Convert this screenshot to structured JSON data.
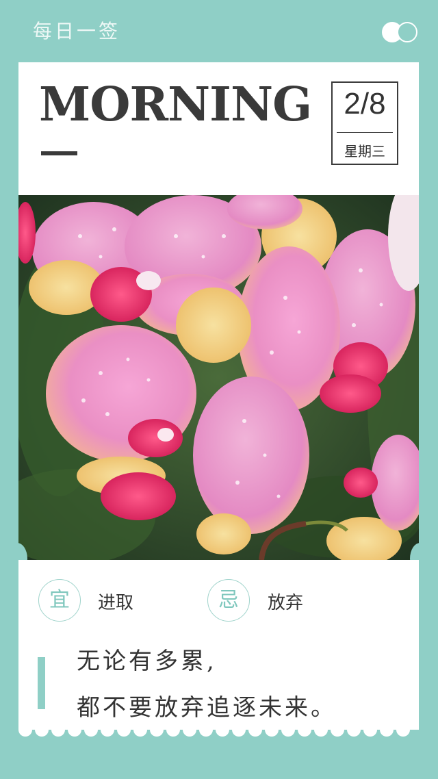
{
  "header": {
    "title": "每日一签",
    "toggle_icon": "toggle-icon"
  },
  "card": {
    "greeting": "MORNING",
    "date": "2/8",
    "weekday": "星期三"
  },
  "photo": {
    "image_icon": "orchid-photo"
  },
  "fortune": {
    "yi_label": "宜",
    "yi_text": "进取",
    "ji_label": "忌",
    "ji_text": "放弃"
  },
  "quote": {
    "line1": "无论有多累,",
    "line2": "都不要放弃追逐未来。"
  },
  "colors": {
    "background": "#8fcfc6",
    "card": "#ffffff",
    "text": "#333333",
    "accent": "#7fc7bd"
  }
}
